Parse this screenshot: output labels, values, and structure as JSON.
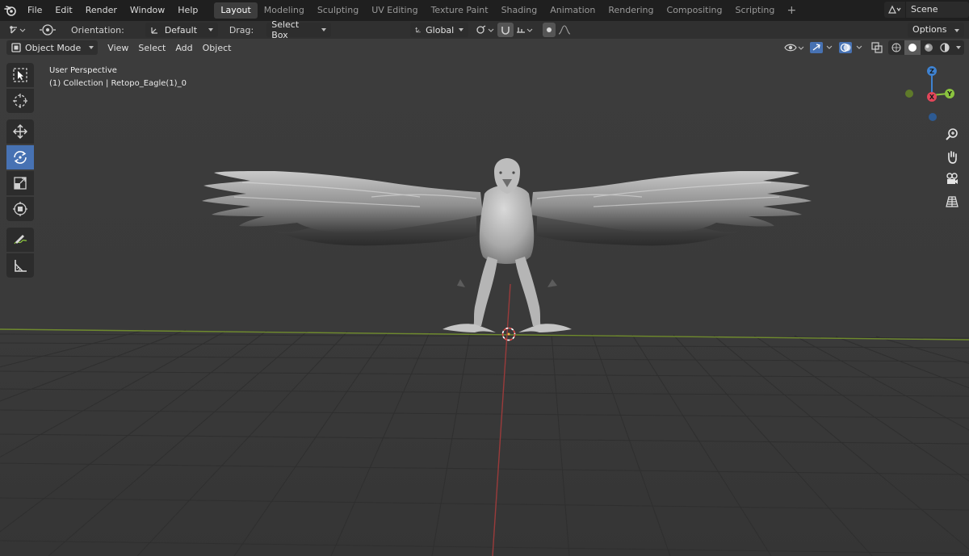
{
  "app": {
    "logo_icon": "blender-logo-icon",
    "menu": [
      "File",
      "Edit",
      "Render",
      "Window",
      "Help"
    ]
  },
  "workspaces": {
    "tabs": [
      "Layout",
      "Modeling",
      "Sculpting",
      "UV Editing",
      "Texture Paint",
      "Shading",
      "Animation",
      "Rendering",
      "Compositing",
      "Scripting"
    ],
    "active": "Layout",
    "add_icon": "plus-icon"
  },
  "scene": {
    "name": "Scene",
    "icon": "scene-icon"
  },
  "tool_header": {
    "orientation_label": "Orientation:",
    "orientation_value": "Default",
    "drag_label": "Drag:",
    "drag_value": "Select Box",
    "transform_orientation": "Global",
    "options_label": "Options"
  },
  "viewport_header": {
    "mode": "Object Mode",
    "menus": [
      "View",
      "Select",
      "Add",
      "Object"
    ]
  },
  "viewport": {
    "view_name": "User Perspective",
    "collection_info": "(1) Collection | Retopo_Eagle(1)_0"
  },
  "toolbar": {
    "tools": [
      "select-box",
      "cursor",
      "move",
      "rotate",
      "scale",
      "transform",
      "annotate",
      "measure"
    ],
    "active_tool": "rotate"
  },
  "gizmo": {
    "axes": [
      "Z",
      "Y",
      "X"
    ],
    "colors": {
      "x": "#e3465a",
      "y": "#8bc43f",
      "z": "#3e82d1"
    }
  },
  "colors": {
    "accent": "#4772b3",
    "background": "#3a3a3a",
    "grid": "#2e2e2e",
    "x_axis_line": "#9a3b3b",
    "y_axis_line": "#6f8a2e"
  }
}
